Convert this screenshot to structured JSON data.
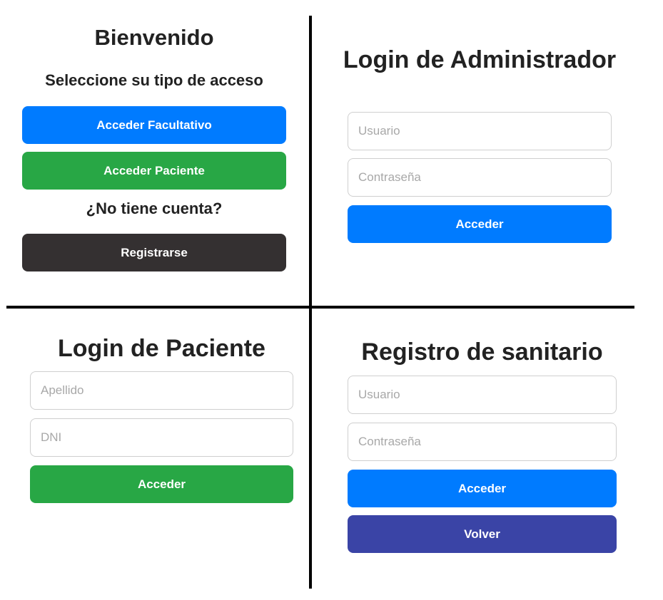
{
  "colors": {
    "primary_blue": "#007bff",
    "success_green": "#28a745",
    "dark": "#343031",
    "indigo": "#3a44a6",
    "divider": "#000000"
  },
  "welcome": {
    "title": "Bienvenido",
    "subtitle": "Seleccione su tipo de acceso",
    "facultativo_button": "Acceder Facultativo",
    "paciente_button": "Acceder Paciente",
    "no_account_text": "¿No tiene cuenta?",
    "register_button": "Registrarse"
  },
  "admin_login": {
    "title": "Login de Administrador",
    "username_placeholder": "Usuario",
    "username_value": "",
    "password_placeholder": "Contraseña",
    "password_value": "",
    "submit_button": "Acceder"
  },
  "patient_login": {
    "title": "Login de Paciente",
    "surname_placeholder": "Apellido",
    "surname_value": "",
    "dni_placeholder": "DNI",
    "dni_value": "",
    "submit_button": "Acceder"
  },
  "sanitario_register": {
    "title": "Registro de sanitario",
    "username_placeholder": "Usuario",
    "username_value": "",
    "password_placeholder": "Contraseña",
    "password_value": "",
    "submit_button": "Acceder",
    "back_button": "Volver"
  }
}
